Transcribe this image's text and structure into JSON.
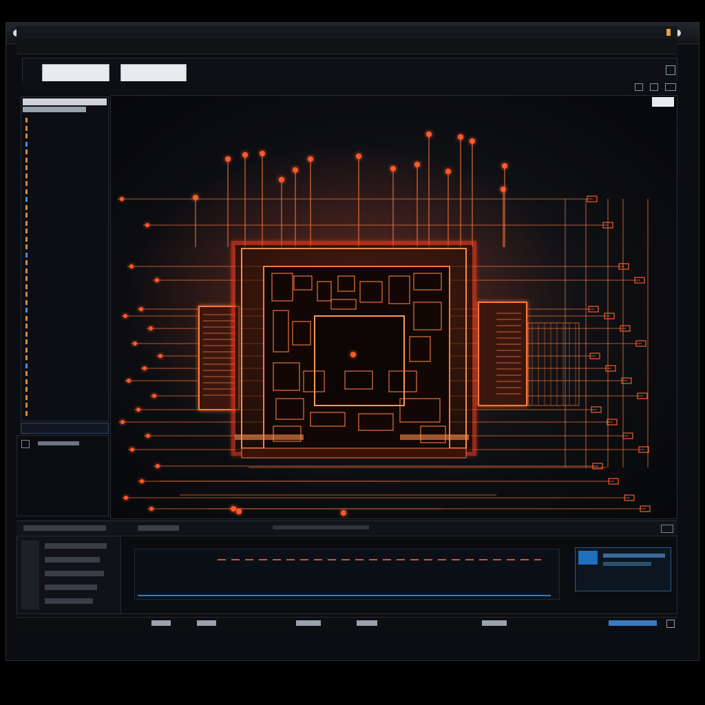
{
  "window": {
    "title_text": "",
    "zoom": ""
  },
  "toolbar": {
    "row1_items": [
      "",
      "",
      "",
      "",
      "",
      ""
    ],
    "row2_items": [
      "",
      "",
      "",
      "",
      "",
      ""
    ]
  },
  "ribbon": {
    "field1_value": "",
    "field2_value": ""
  },
  "menubar": {
    "items": [
      "",
      "",
      "",
      "",
      "",
      "",
      "",
      ""
    ]
  },
  "sidebar": {
    "items": [
      "",
      "",
      "",
      "",
      "",
      "",
      "",
      "",
      "",
      "",
      "",
      "",
      "",
      "",
      "",
      "",
      "",
      "",
      "",
      "",
      "",
      "",
      "",
      "",
      "",
      "",
      "",
      "",
      "",
      "",
      "",
      "",
      "",
      "",
      "",
      "",
      "",
      ""
    ],
    "footer": ""
  },
  "canvas": {
    "title": "",
    "caption": ""
  },
  "console": {
    "lines": [
      "",
      "",
      "",
      "",
      ""
    ],
    "prompt": ""
  },
  "colors": {
    "accent": "#ff5a2a",
    "trace": "#ff7a3c",
    "glow": "#ff3d1f",
    "panel": "#0b0d12",
    "preview": "#1f6fbf"
  }
}
